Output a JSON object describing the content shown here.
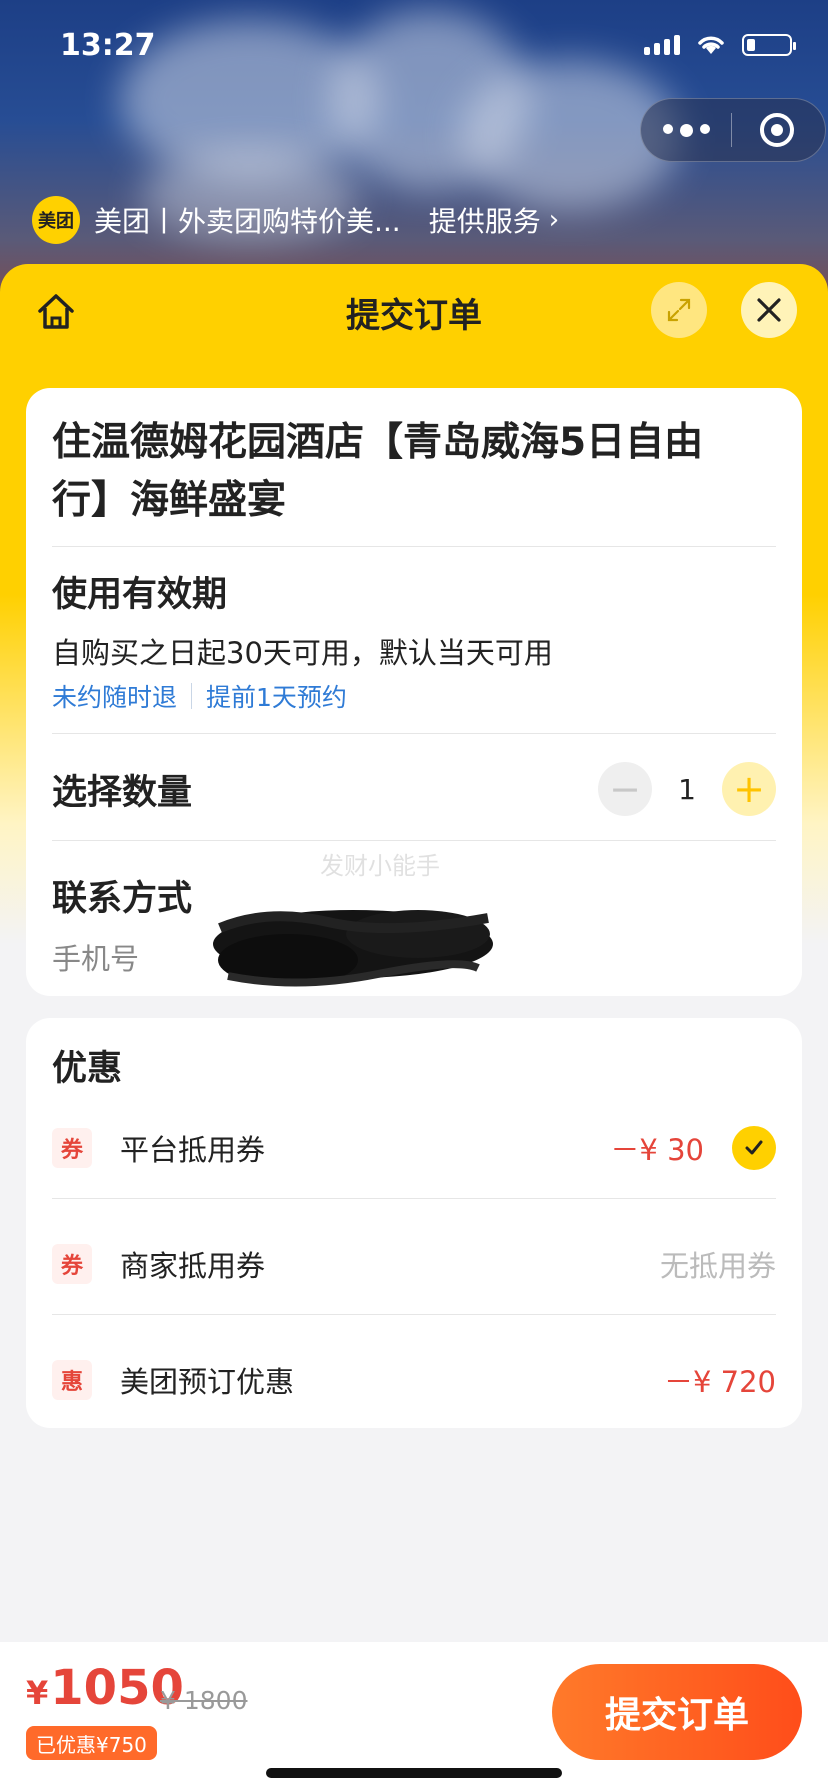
{
  "status_bar": {
    "time": "13:27"
  },
  "miniapp": {
    "logo_text": "美团",
    "name": "美团丨外卖团购特价美...",
    "service_label": "提供服务",
    "service_chevron": "›"
  },
  "sheet": {
    "title": "提交订单"
  },
  "order": {
    "hotel_title": "住温德姆花园酒店【青岛威海5日自由行】海鲜盛宴",
    "validity": {
      "title": "使用有效期",
      "text": "自购买之日起30天可用，默认当天可用",
      "tags": [
        "未约随时退",
        "提前1天预约"
      ]
    },
    "quantity": {
      "title": "选择数量",
      "value": "1",
      "minus": "−",
      "plus": "+"
    },
    "contact": {
      "title": "联系方式",
      "phone_label": "手机号"
    },
    "watermark": "发财小能手"
  },
  "discounts": {
    "title": "优惠",
    "items": [
      {
        "icon": "券",
        "label": "平台抵用券",
        "value": "－¥ 30",
        "selected": true
      },
      {
        "icon": "券",
        "label": "商家抵用券",
        "value": "无抵用券",
        "selected": false
      },
      {
        "icon": "惠",
        "label": "美团预订优惠",
        "value": "－¥ 720",
        "selected": false
      }
    ]
  },
  "footer": {
    "currency": "¥",
    "price": "1050",
    "original_price": "¥ 1800",
    "saved": "已优惠¥750",
    "submit": "提交订单"
  },
  "colors": {
    "brand_yellow": "#ffd000",
    "accent_red": "#e5453a",
    "link_blue": "#2f7bd6",
    "cta_orange": "#ff5a1f"
  }
}
